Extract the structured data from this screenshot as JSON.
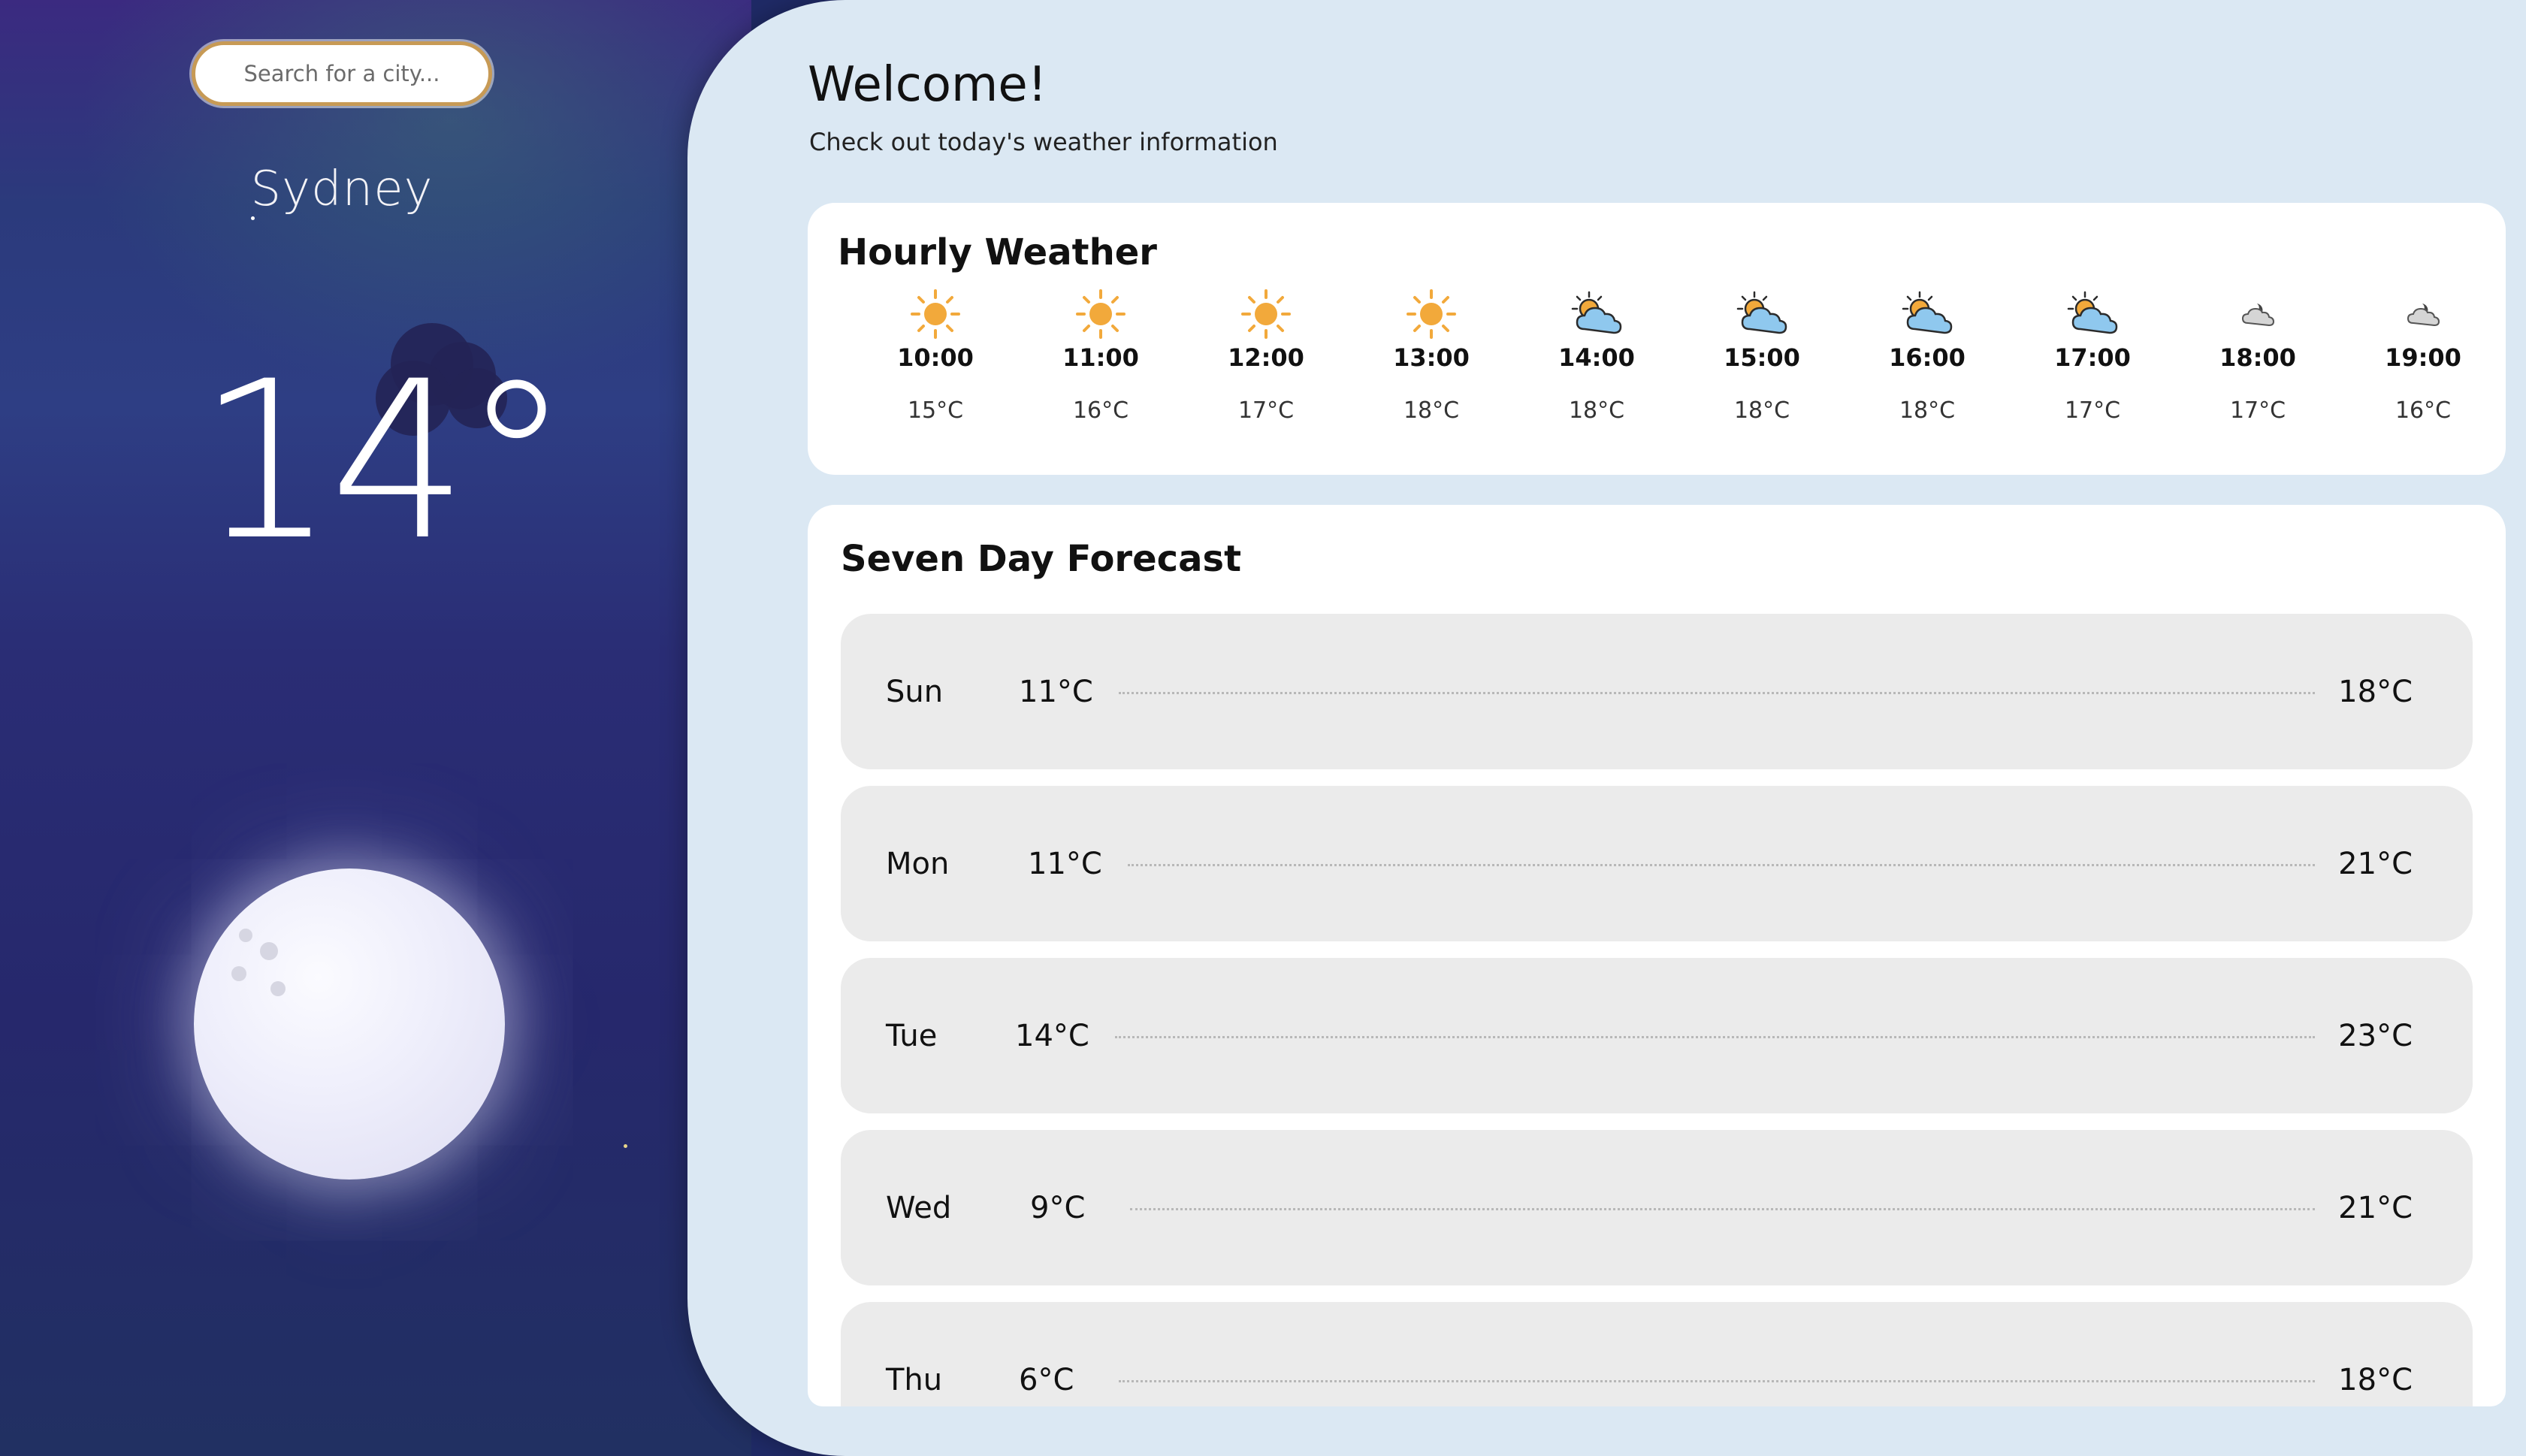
{
  "search": {
    "placeholder": "Search for a city..."
  },
  "location": {
    "city": "Sydney",
    "current_temp": "14°"
  },
  "header": {
    "title": "Welcome!",
    "subtitle": "Check out today's weather information"
  },
  "hourly": {
    "title": "Hourly Weather",
    "items": [
      {
        "time": "10:00",
        "temp": "15°C",
        "icon": "sun-icon"
      },
      {
        "time": "11:00",
        "temp": "16°C",
        "icon": "sun-icon"
      },
      {
        "time": "12:00",
        "temp": "17°C",
        "icon": "sun-icon"
      },
      {
        "time": "13:00",
        "temp": "18°C",
        "icon": "sun-icon"
      },
      {
        "time": "14:00",
        "temp": "18°C",
        "icon": "partly-cloudy-icon"
      },
      {
        "time": "15:00",
        "temp": "18°C",
        "icon": "partly-cloudy-icon"
      },
      {
        "time": "16:00",
        "temp": "18°C",
        "icon": "partly-cloudy-icon"
      },
      {
        "time": "17:00",
        "temp": "17°C",
        "icon": "partly-cloudy-icon"
      },
      {
        "time": "18:00",
        "temp": "17°C",
        "icon": "cloudy-night-icon"
      },
      {
        "time": "19:00",
        "temp": "16°C",
        "icon": "cloudy-night-icon"
      }
    ]
  },
  "forecast": {
    "title": "Seven Day Forecast",
    "days": [
      {
        "day": "Sun",
        "low": "11°C",
        "high": "18°C"
      },
      {
        "day": "Mon",
        "low": "11°C",
        "high": "21°C"
      },
      {
        "day": "Tue",
        "low": "14°C",
        "high": "23°C"
      },
      {
        "day": "Wed",
        "low": "9°C",
        "high": "21°C"
      },
      {
        "day": "Thu",
        "low": "6°C",
        "high": "18°C"
      }
    ]
  },
  "colors": {
    "sun": "#f2a93b",
    "cloud": "#8fc8ee",
    "search_border": "#c79a55",
    "panel_bg": "#dbe8f3",
    "row_bg": "#ebebeb"
  }
}
